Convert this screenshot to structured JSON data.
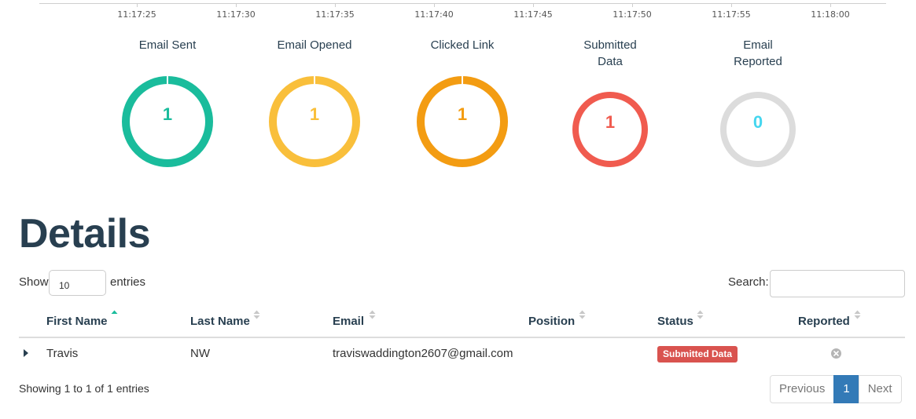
{
  "timeline": {
    "ticks": [
      "11:17:25",
      "11:17:30",
      "11:17:35",
      "11:17:40",
      "11:17:45",
      "11:17:50",
      "11:17:55",
      "11:18:00"
    ]
  },
  "stats": [
    {
      "title": "Email Sent",
      "value": "1",
      "color": "#1abc9c"
    },
    {
      "title": "Email Opened",
      "value": "1",
      "color": "#f9bf3b"
    },
    {
      "title": "Clicked Link",
      "value": "1",
      "color": "#f39c12"
    },
    {
      "title": "Submitted Data",
      "value": "1",
      "color": "#f05b4f"
    },
    {
      "title": "Email Reported",
      "value": "0",
      "color": "#45d6ef"
    }
  ],
  "details": {
    "heading": "Details",
    "show_label": "Show",
    "length_value": "10",
    "entries_label": "entries",
    "search_label": "Search:",
    "search_value": "",
    "columns": [
      "First Name",
      "Last Name",
      "Email",
      "Position",
      "Status",
      "Reported"
    ],
    "sorted_column": "First Name",
    "rows": [
      {
        "first_name": "Travis",
        "last_name": "NW",
        "email": "traviswaddington2607@gmail.com",
        "position": "",
        "status": "Submitted Data",
        "status_color": "#d9534f",
        "reported_icon": "circle-x-icon"
      }
    ],
    "info": "Showing 1 to 1 of 1 entries",
    "pagination": {
      "previous": "Previous",
      "current": "1",
      "next": "Next"
    }
  }
}
